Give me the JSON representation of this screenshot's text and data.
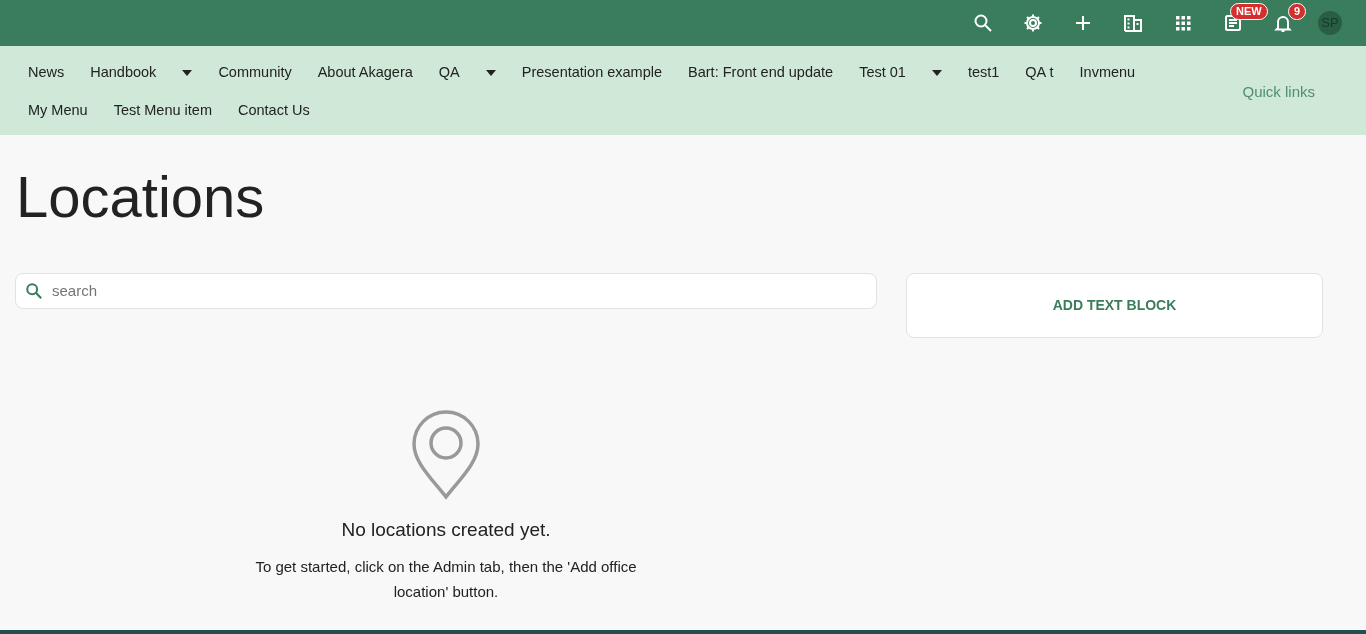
{
  "top_bar": {
    "icons": [
      {
        "kind": "search"
      },
      {
        "kind": "gear"
      },
      {
        "kind": "plus"
      },
      {
        "kind": "building"
      },
      {
        "kind": "apps"
      },
      {
        "kind": "news",
        "badge": "NEW"
      },
      {
        "kind": "bell",
        "badge": "9"
      }
    ],
    "avatar": "SP"
  },
  "nav": {
    "items": [
      {
        "label": "News",
        "dropdown": false
      },
      {
        "label": "Handbook",
        "dropdown": true
      },
      {
        "label": "Community",
        "dropdown": false
      },
      {
        "label": "About Akagera",
        "dropdown": false
      },
      {
        "label": "QA",
        "dropdown": true
      },
      {
        "label": "Presentation example",
        "dropdown": false
      },
      {
        "label": "Bart: Front end update",
        "dropdown": false
      },
      {
        "label": "Test 01",
        "dropdown": true
      },
      {
        "label": "test1",
        "dropdown": false
      },
      {
        "label": "QA t",
        "dropdown": false
      },
      {
        "label": "Invmenu",
        "dropdown": false
      },
      {
        "label": "My Menu",
        "dropdown": false
      },
      {
        "label": "Test Menu item",
        "dropdown": false
      },
      {
        "label": "Contact Us",
        "dropdown": false
      }
    ],
    "quick_links": "Quick links"
  },
  "page": {
    "title": "Locations",
    "search": {
      "placeholder": "search"
    },
    "add_button": "ADD TEXT BLOCK",
    "empty_state": {
      "heading": "No locations created yet.",
      "message": "To get started, click on the Admin tab, then the 'Add office location' button."
    }
  }
}
